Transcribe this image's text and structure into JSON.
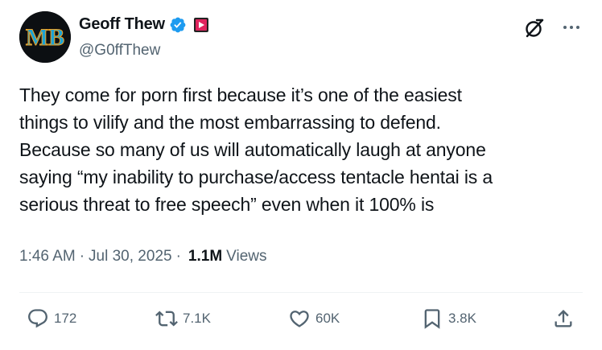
{
  "author": {
    "display_name": "Geoff Thew",
    "handle": "@G0ffThew",
    "avatar_text": "MB",
    "verified_icon": "verified-badge-icon",
    "affiliate_icon": "play-badge-icon"
  },
  "header": {
    "grok_icon": "grok-icon",
    "more_icon": "more-options-icon"
  },
  "post": {
    "text": "They come for porn first because it’s one of the easiest\nthings to vilify and the most embarrassing to defend.\nBecause so many of us will automatically laugh at anyone\nsaying “my inability to purchase/access tentacle hentai is a\nserious threat to free speech” even when it 100% is"
  },
  "meta": {
    "time": "1:46 AM",
    "separator": "·",
    "date": "Jul 30, 2025",
    "views_count": "1.1M",
    "views_label": "Views"
  },
  "actions": {
    "replies": "172",
    "reposts": "7.1K",
    "likes": "60K",
    "bookmarks": "3.8K"
  },
  "colors": {
    "text": "#0f1419",
    "secondary": "#536471",
    "verified": "#1d9bf0",
    "affiliate": "#e0245e"
  }
}
